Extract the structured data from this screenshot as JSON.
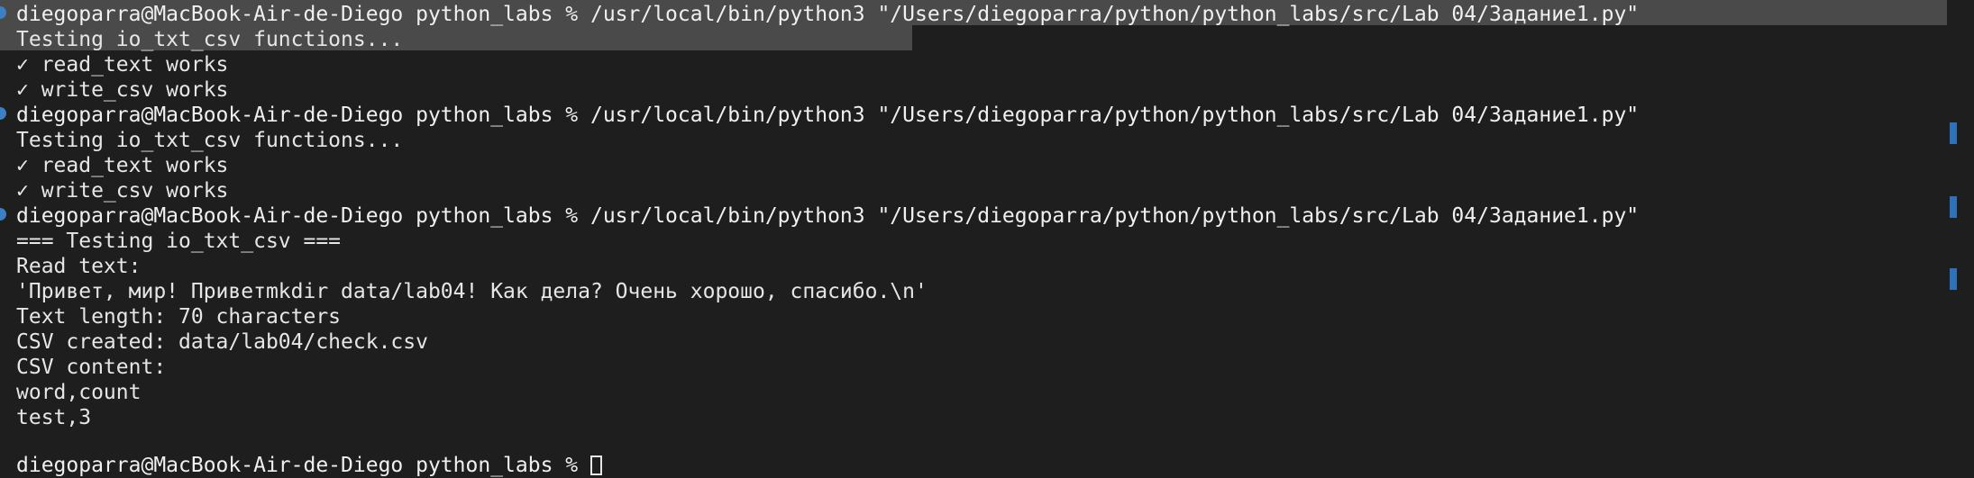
{
  "terminal": {
    "lines": [
      "diegoparra@MacBook-Air-de-Diego python_labs % /usr/local/bin/python3 \"/Users/diegoparra/python/python_labs/src/Lab 04/Задание1.py\"",
      "Testing io_txt_csv functions...",
      "✓ read_text works",
      "✓ write_csv works",
      "diegoparra@MacBook-Air-de-Diego python_labs % /usr/local/bin/python3 \"/Users/diegoparra/python/python_labs/src/Lab 04/Задание1.py\"",
      "Testing io_txt_csv functions...",
      "✓ read_text works",
      "✓ write_csv works",
      "diegoparra@MacBook-Air-de-Diego python_labs % /usr/local/bin/python3 \"/Users/diegoparra/python/python_labs/src/Lab 04/Задание1.py\"",
      "=== Testing io_txt_csv ===",
      "Read text:",
      "'Привет, мир! Приветmkdir data/lab04! Как дела? Очень хорошо, спасибо.\\n'",
      "Text length: 70 characters",
      "CSV created: data/lab04/check.csv",
      "CSV content:",
      "word,count",
      "test,3",
      "",
      "diegoparra@MacBook-Air-de-Diego python_labs % "
    ]
  },
  "colors": {
    "background": "#1e1e1e",
    "text": "#e6e6e6",
    "selection": "#4a4a4a",
    "decoration_blue": "#3b7fc4",
    "scroll_mark_blue": "#2d72b9"
  }
}
